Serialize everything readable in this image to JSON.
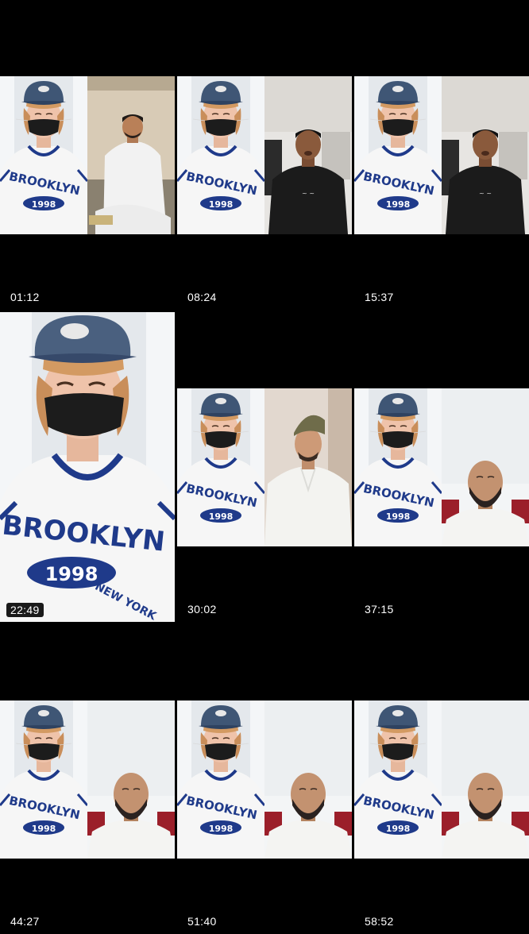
{
  "thumbnails": [
    {
      "time": "01:12",
      "right": "man_white_sitting"
    },
    {
      "time": "08:24",
      "right": "man_black_tee"
    },
    {
      "time": "15:37",
      "right": "man_black_tee"
    },
    {
      "time": "22:49",
      "right": "none",
      "selected": true
    },
    {
      "time": "30:02",
      "right": "man_cap_white"
    },
    {
      "time": "37:15",
      "right": "bald_man"
    },
    {
      "time": "44:27",
      "right": "bald_man"
    },
    {
      "time": "51:40",
      "right": "bald_man"
    },
    {
      "time": "58:52",
      "right": "bald_man"
    }
  ],
  "shirt_text": {
    "brand": "BROOKLYN",
    "year": "1998",
    "city": "NEW YORK"
  },
  "colors": {
    "background": "#000000",
    "navy": "#1f3a8a",
    "mask": "#1c1c1c",
    "cap": "#3f5675",
    "wall": "#e9edf1"
  }
}
